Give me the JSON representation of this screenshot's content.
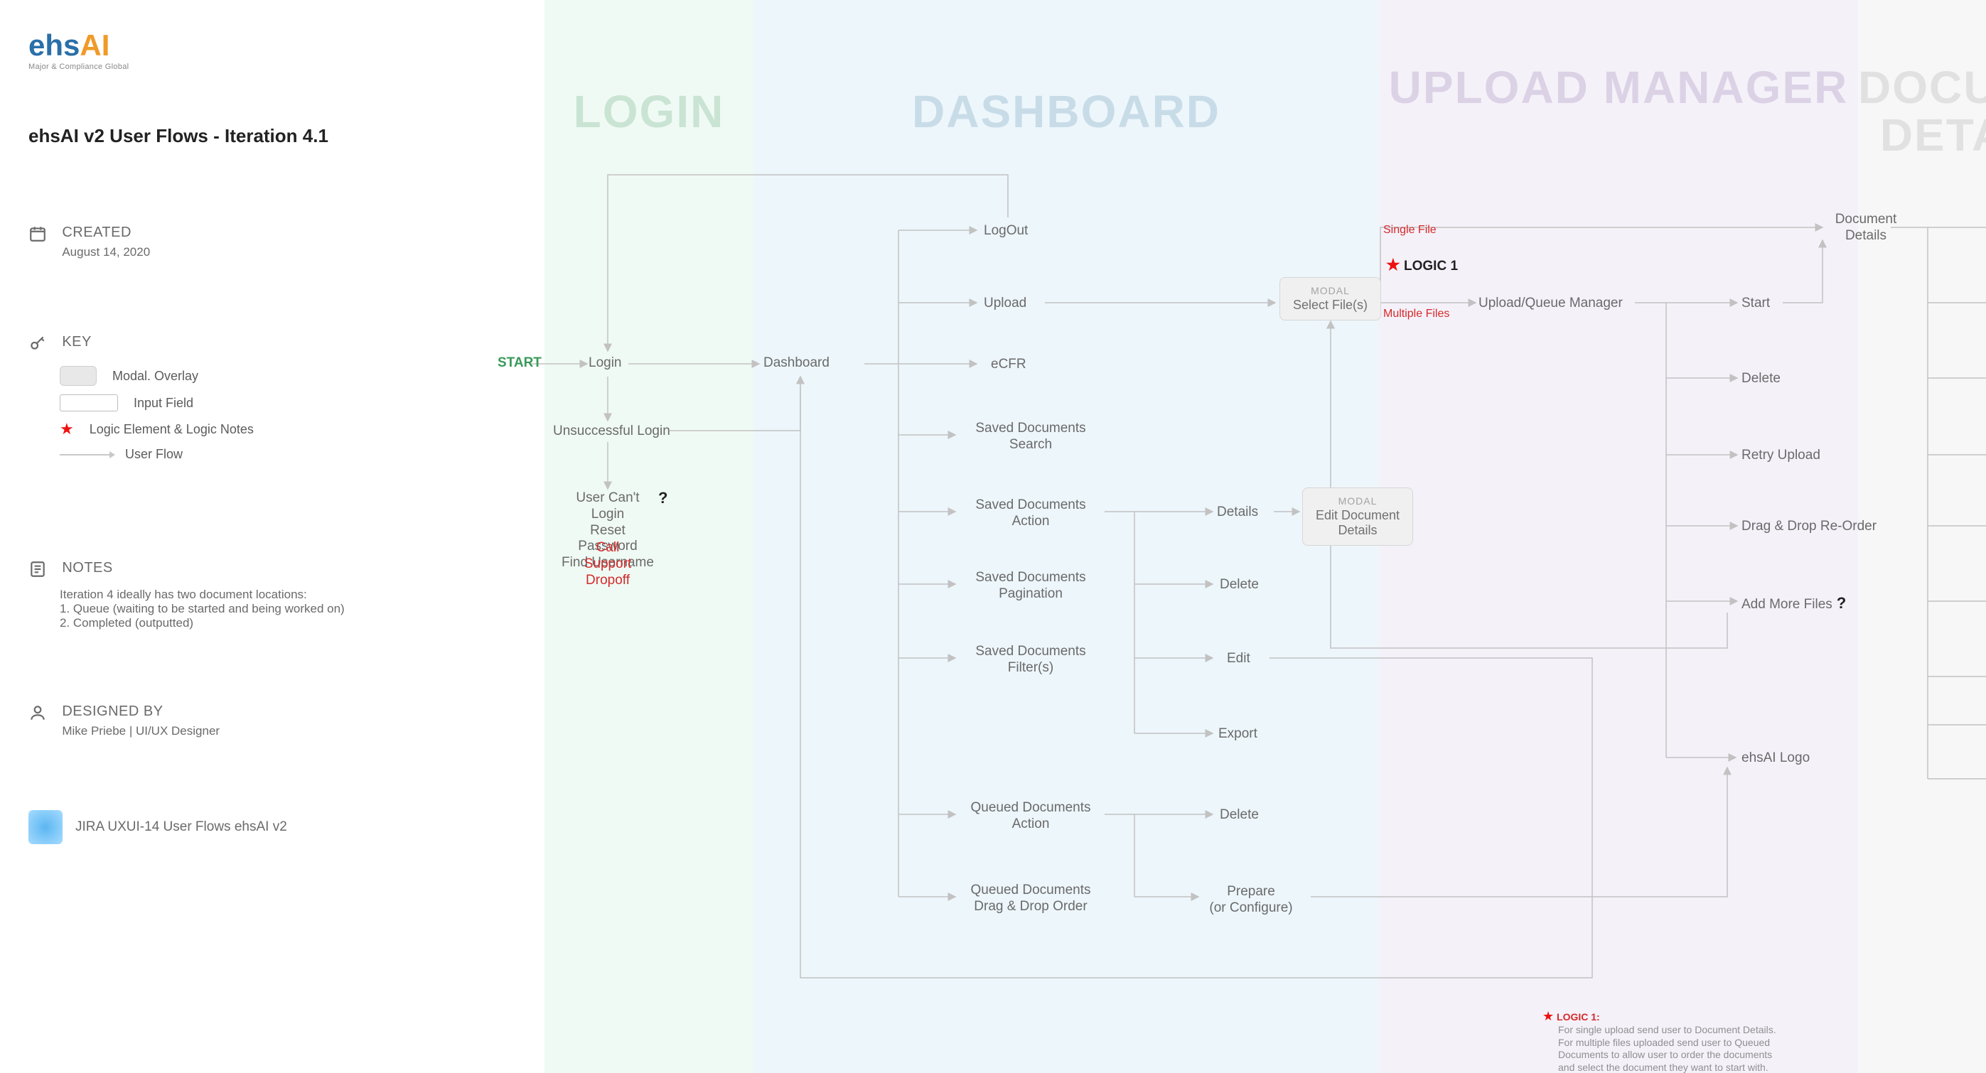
{
  "logo": {
    "text": "ehsAI",
    "tag": "Major & Compliance Global"
  },
  "title": "ehsAI v2 User Flows - Iteration 4.1",
  "meta": {
    "created_label": "CREATED",
    "created_value": "August 14, 2020",
    "key_label": "KEY",
    "key_items": {
      "modal": "Modal. Overlay",
      "input": "Input Field",
      "logic": "Logic Element & Logic Notes",
      "flow": "User Flow"
    },
    "notes_label": "NOTES",
    "notes_body": "Iteration 4 ideally has two document locations:\n1. Queue (waiting to be started and being worked on)\n2. Completed (outputted)",
    "designed_label": "DESIGNED BY",
    "designed_value": "Mike Priebe | UI/UX Designer",
    "jira": "JIRA  UXUI-14 User Flows ehsAI v2"
  },
  "lanes": {
    "login": "LOGIN",
    "dashboard": "DASHBOARD",
    "upload": "UPLOAD MANAGER",
    "detail": "DOCUMENT DETAIL"
  },
  "flow": {
    "start": "START",
    "login": "Login",
    "unsuccessful": "Unsuccessful Login",
    "cantlogin": "User Can't Login\nReset Password\nFind Username",
    "cantlogin_red": "Call Support\nDropoff",
    "dashboard": "Dashboard",
    "logout": "LogOut",
    "upload": "Upload",
    "ecfr": "eCFR",
    "saved_search": "Saved Documents\nSearch",
    "saved_action": "Saved Documents\nAction",
    "saved_pag": "Saved Documents\nPagination",
    "saved_filter": "Saved Documents\nFilter(s)",
    "queued_action": "Queued Documents\nAction",
    "queued_dnd": "Queued Documents\nDrag & Drop Order",
    "details": "Details",
    "delete": "Delete",
    "edit": "Edit",
    "export": "Export",
    "prepare": "Prepare\n(or Configure)",
    "select_files_tag": "MODAL",
    "select_files": "Select File(s)",
    "edit_doc_tag": "MODAL",
    "edit_doc": "Edit Document\nDetails",
    "single_file": "Single File",
    "multi_file": "Multiple Files",
    "logic1": "LOGIC 1",
    "uqm": "Upload/Queue Manager",
    "mgr_start": "Start",
    "mgr_delete": "Delete",
    "mgr_retry": "Retry Upload",
    "mgr_reorder": "Drag & Drop Re-Order",
    "mgr_addmore": "Add More Files",
    "mgr_logo": "ehsAI Logo",
    "doc_details": "Document\nDetails",
    "logic1_title": "LOGIC 1:",
    "logic1_body": "For single upload send user to Document Details.\nFor multiple files uploaded send user to Queued\nDocuments to allow user to order the documents\nand select the document they want to start with."
  },
  "lane_colors": {
    "login": "#f0faf4",
    "dashboard": "#edf6fb",
    "upload": "#f5f1f9",
    "detail": "#f7f7f7"
  }
}
